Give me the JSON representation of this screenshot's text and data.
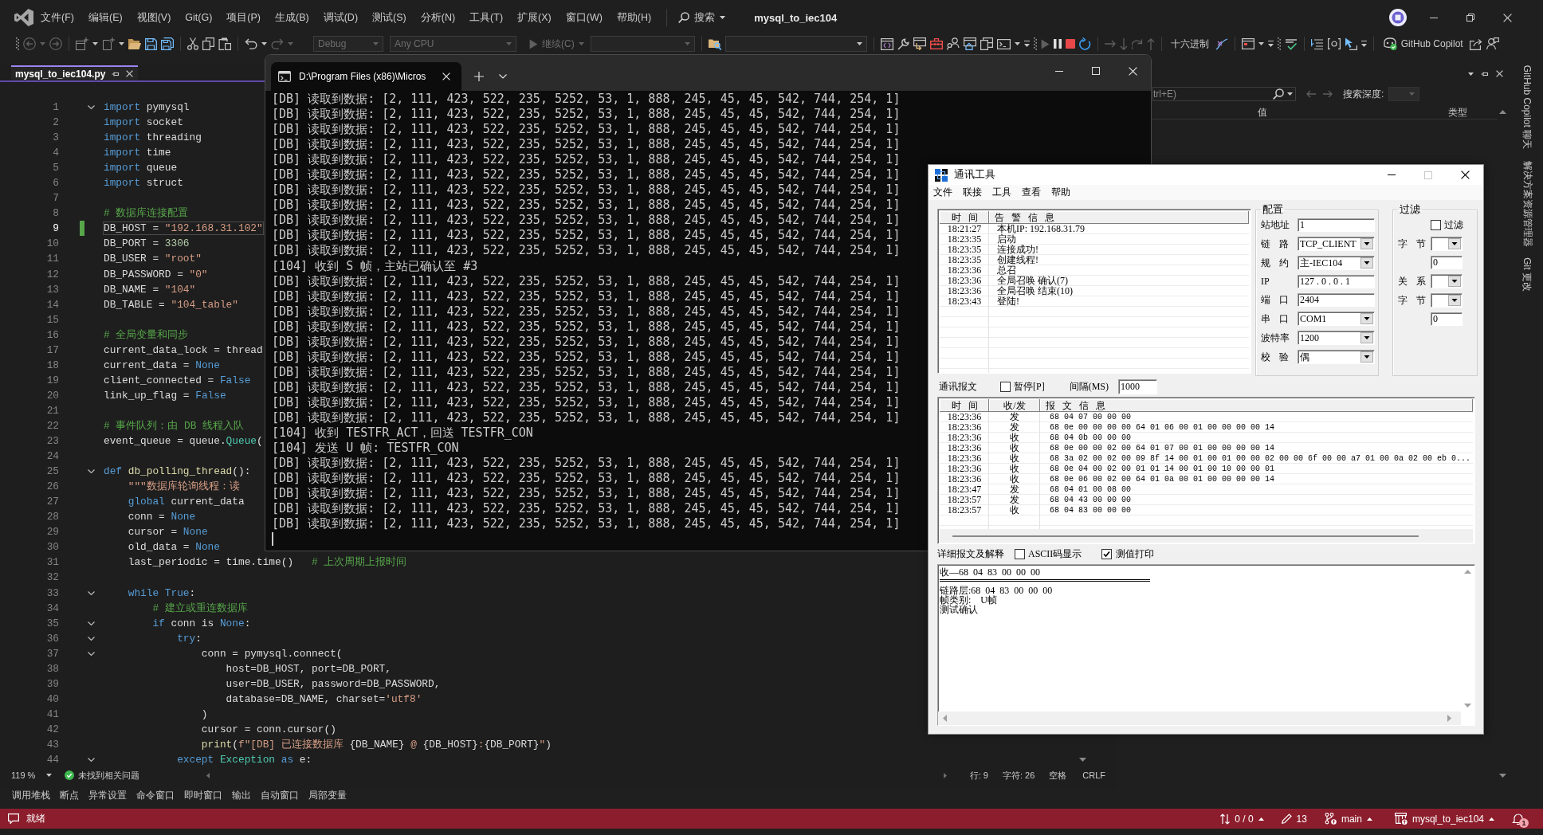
{
  "title_bar": {
    "menus": [
      "文件(F)",
      "编辑(E)",
      "视图(V)",
      "Git(G)",
      "项目(P)",
      "生成(B)",
      "调试(D)",
      "测试(S)",
      "分析(N)",
      "工具(T)",
      "扩展(X)",
      "窗口(W)",
      "帮助(H)"
    ],
    "search": "搜索",
    "title": "mysql_to_iec104"
  },
  "toolbar": {
    "configuration": {
      "value": "Debug",
      "disabled": true
    },
    "platform": {
      "value": "Any CPU",
      "disabled": true
    },
    "continue": {
      "label": "继续(C)",
      "disabled": true
    },
    "hex": "十六进制",
    "copilot": "GitHub Copilot"
  },
  "document_tab": {
    "label": "mysql_to_iec104.py",
    "selected": true
  },
  "editor": {
    "lines": [
      {
        "number": "1",
        "selected": false,
        "modified": false,
        "expanded": true,
        "segments": [
          {
            "kind": "keyword",
            "text": "import"
          },
          {
            "kind": "plain",
            "text": " pymysql"
          }
        ]
      },
      {
        "number": "2",
        "selected": false,
        "modified": false,
        "segments": [
          {
            "kind": "keyword",
            "text": "import"
          },
          {
            "kind": "plain",
            "text": " socket"
          }
        ]
      },
      {
        "number": "3",
        "selected": false,
        "modified": false,
        "segments": [
          {
            "kind": "keyword",
            "text": "import"
          },
          {
            "kind": "plain",
            "text": " threading"
          }
        ]
      },
      {
        "number": "4",
        "selected": false,
        "modified": false,
        "segments": [
          {
            "kind": "keyword",
            "text": "import"
          },
          {
            "kind": "plain",
            "text": " time"
          }
        ]
      },
      {
        "number": "5",
        "selected": false,
        "modified": false,
        "segments": [
          {
            "kind": "keyword",
            "text": "import"
          },
          {
            "kind": "plain",
            "text": " queue"
          }
        ]
      },
      {
        "number": "6",
        "selected": false,
        "modified": false,
        "segments": [
          {
            "kind": "keyword",
            "text": "import"
          },
          {
            "kind": "plain",
            "text": " struct"
          }
        ]
      },
      {
        "number": "7",
        "selected": false,
        "modified": false
      },
      {
        "number": "8",
        "selected": false,
        "modified": false,
        "segments": [
          {
            "kind": "comment",
            "text": "# 数据库连接配置"
          }
        ]
      },
      {
        "number": "9",
        "selected": true,
        "modified": true,
        "segments": [
          {
            "kind": "plain",
            "text": "DB_HOST = "
          },
          {
            "kind": "string",
            "text": "\"192.168.31.102\""
          }
        ]
      },
      {
        "number": "10",
        "selected": false,
        "modified": false,
        "segments": [
          {
            "kind": "plain",
            "text": "DB_PORT = "
          },
          {
            "kind": "number",
            "text": "3306"
          }
        ]
      },
      {
        "number": "11",
        "selected": false,
        "modified": false,
        "segments": [
          {
            "kind": "plain",
            "text": "DB_USER = "
          },
          {
            "kind": "string",
            "text": "\"root\""
          }
        ]
      },
      {
        "number": "12",
        "selected": false,
        "modified": false,
        "segments": [
          {
            "kind": "plain",
            "text": "DB_PASSWORD = "
          },
          {
            "kind": "string",
            "text": "\"0\""
          }
        ]
      },
      {
        "number": "13",
        "selected": false,
        "modified": false,
        "segments": [
          {
            "kind": "plain",
            "text": "DB_NAME = "
          },
          {
            "kind": "string",
            "text": "\"104\""
          }
        ]
      },
      {
        "number": "14",
        "selected": false,
        "modified": false,
        "segments": [
          {
            "kind": "plain",
            "text": "DB_TABLE = "
          },
          {
            "kind": "string",
            "text": "\"104_table\""
          }
        ]
      },
      {
        "number": "15",
        "selected": false,
        "modified": false
      },
      {
        "number": "16",
        "selected": false,
        "modified": false,
        "segments": [
          {
            "kind": "comment",
            "text": "# 全局变量和同步"
          }
        ]
      },
      {
        "number": "17",
        "selected": false,
        "modified": false,
        "segments": [
          {
            "kind": "plain",
            "text": "current_data_lock = thread"
          }
        ]
      },
      {
        "number": "18",
        "selected": false,
        "modified": false,
        "segments": [
          {
            "kind": "plain",
            "text": "current_data = "
          },
          {
            "kind": "keyword",
            "text": "None"
          }
        ]
      },
      {
        "number": "19",
        "selected": false,
        "modified": false,
        "segments": [
          {
            "kind": "plain",
            "text": "client_connected = "
          },
          {
            "kind": "keyword",
            "text": "False"
          }
        ]
      },
      {
        "number": "20",
        "selected": false,
        "modified": false,
        "segments": [
          {
            "kind": "plain",
            "text": "link_up_flag = "
          },
          {
            "kind": "keyword",
            "text": "False"
          }
        ]
      },
      {
        "number": "21",
        "selected": false,
        "modified": false
      },
      {
        "number": "22",
        "selected": false,
        "modified": false,
        "segments": [
          {
            "kind": "comment",
            "text": "# 事件队列：由 DB 线程入队"
          }
        ]
      },
      {
        "number": "23",
        "selected": false,
        "modified": false,
        "segments": [
          {
            "kind": "plain",
            "text": "event_queue = queue."
          },
          {
            "kind": "class",
            "text": "Queue"
          },
          {
            "kind": "plain",
            "text": "("
          }
        ]
      },
      {
        "number": "24",
        "selected": false,
        "modified": false
      },
      {
        "number": "25",
        "selected": false,
        "modified": false,
        "expanded": true,
        "segments": [
          {
            "kind": "keyword",
            "text": "def"
          },
          {
            "kind": "function",
            "text": " db_polling_thread"
          },
          {
            "kind": "plain",
            "text": "():"
          }
        ]
      },
      {
        "number": "26",
        "selected": false,
        "modified": false,
        "segments": [
          {
            "kind": "string",
            "text": "    \"\"\"数据库轮询线程：读"
          }
        ]
      },
      {
        "number": "27",
        "selected": false,
        "modified": false,
        "segments": [
          {
            "kind": "keyword",
            "text": "    global"
          },
          {
            "kind": "plain",
            "text": " current_data"
          }
        ]
      },
      {
        "number": "28",
        "selected": false,
        "modified": false,
        "segments": [
          {
            "kind": "plain",
            "text": "    conn = "
          },
          {
            "kind": "keyword",
            "text": "None"
          }
        ]
      },
      {
        "number": "29",
        "selected": false,
        "modified": false,
        "segments": [
          {
            "kind": "plain",
            "text": "    cursor = "
          },
          {
            "kind": "keyword",
            "text": "None"
          }
        ]
      },
      {
        "number": "30",
        "selected": false,
        "modified": false,
        "segments": [
          {
            "kind": "plain",
            "text": "    old_data = "
          },
          {
            "kind": "keyword",
            "text": "None"
          }
        ]
      },
      {
        "number": "31",
        "selected": false,
        "modified": false,
        "segments": [
          {
            "kind": "plain",
            "text": "    last_periodic = time.time()   "
          },
          {
            "kind": "comment",
            "text": "# 上次周期上报时间"
          }
        ]
      },
      {
        "number": "32",
        "selected": false,
        "modified": false
      },
      {
        "number": "33",
        "selected": false,
        "modified": false,
        "expanded": true,
        "segments": [
          {
            "kind": "keyword",
            "text": "    while True"
          },
          {
            "kind": "plain",
            "text": ":"
          }
        ]
      },
      {
        "number": "34",
        "selected": false,
        "modified": false,
        "segments": [
          {
            "kind": "comment",
            "text": "        # 建立或重连数据库"
          }
        ]
      },
      {
        "number": "35",
        "selected": false,
        "modified": false,
        "expanded": true,
        "segments": [
          {
            "kind": "keyword",
            "text": "        if"
          },
          {
            "kind": "plain",
            "text": " conn is "
          },
          {
            "kind": "keyword",
            "text": "None"
          },
          {
            "kind": "plain",
            "text": ":"
          }
        ]
      },
      {
        "number": "36",
        "selected": false,
        "modified": false,
        "expanded": true,
        "segments": [
          {
            "kind": "keyword",
            "text": "            try"
          },
          {
            "kind": "plain",
            "text": ":"
          }
        ]
      },
      {
        "number": "37",
        "selected": false,
        "modified": false,
        "expanded": true,
        "segments": [
          {
            "kind": "plain",
            "text": "                conn = pymysql.connect("
          }
        ]
      },
      {
        "number": "38",
        "selected": false,
        "modified": false,
        "segments": [
          {
            "kind": "plain",
            "text": "                    host=DB_HOST, port=DB_PORT,"
          }
        ]
      },
      {
        "number": "39",
        "selected": false,
        "modified": false,
        "segments": [
          {
            "kind": "plain",
            "text": "                    user=DB_USER, password=DB_PASSWORD,"
          }
        ]
      },
      {
        "number": "40",
        "selected": false,
        "modified": false,
        "segments": [
          {
            "kind": "plain",
            "text": "                    database=DB_NAME, charset="
          },
          {
            "kind": "string",
            "text": "'utf8'"
          }
        ]
      },
      {
        "number": "41",
        "selected": false,
        "modified": false,
        "segments": [
          {
            "kind": "plain",
            "text": "                )"
          }
        ]
      },
      {
        "number": "42",
        "selected": false,
        "modified": false,
        "segments": [
          {
            "kind": "plain",
            "text": "                cursor = conn.cursor()"
          }
        ]
      },
      {
        "number": "43",
        "selected": false,
        "modified": false,
        "segments": [
          {
            "kind": "function",
            "text": "                print"
          },
          {
            "kind": "plain",
            "text": "("
          },
          {
            "kind": "string",
            "text": "f\"[DB] 已连接数据库 "
          },
          {
            "kind": "plain",
            "text": "{DB_NAME}"
          },
          {
            "kind": "string",
            "text": " @ "
          },
          {
            "kind": "plain",
            "text": "{DB_HOST}"
          },
          {
            "kind": "string",
            "text": ":"
          },
          {
            "kind": "plain",
            "text": "{DB_PORT}"
          },
          {
            "kind": "string",
            "text": "\""
          },
          {
            "kind": "plain",
            "text": ")"
          }
        ]
      },
      {
        "number": "44",
        "selected": false,
        "modified": false,
        "expanded": true,
        "segments": [
          {
            "kind": "keyword",
            "text": "            except"
          },
          {
            "kind": "class",
            "text": " Exception"
          },
          {
            "kind": "keyword",
            "text": " as"
          },
          {
            "kind": "plain",
            "text": " e:"
          }
        ]
      }
    ],
    "status": {
      "zoom": "119 %",
      "issues": "未找到相关问题",
      "line": "行: 9",
      "column": "字符: 26",
      "indentation": "空格",
      "line_ending": "CRLF"
    }
  },
  "locals_panel": {
    "search": {
      "placeholder": "trl+E)"
    },
    "depth_label": "搜索深度:",
    "columns": [
      "值",
      "类型"
    ]
  },
  "side_tabs": [
    "GitHub Copilot 聊天",
    "解决方案资源管理器",
    "Git 更改"
  ],
  "tool_tabs": [
    "调用堆栈",
    "断点",
    "异常设置",
    "命令窗口",
    "即时窗口",
    "输出",
    "自动窗口",
    "局部变量"
  ],
  "status_bar": {
    "state": "就绪",
    "changes": "0 / 0",
    "edits": "13",
    "branch": "main",
    "repository": "mysql_to_iec104",
    "notifications": "1"
  },
  "terminal": {
    "tab_title": "D:\\Program Files (x86)\\Micros",
    "lines": [
      "[DB] 读取到数据: [2, 111, 423, 522, 235, 5252, 53, 1, 888, 245, 45, 45, 542, 744, 254, 1]",
      "[DB] 读取到数据: [2, 111, 423, 522, 235, 5252, 53, 1, 888, 245, 45, 45, 542, 744, 254, 1]",
      "[DB] 读取到数据: [2, 111, 423, 522, 235, 5252, 53, 1, 888, 245, 45, 45, 542, 744, 254, 1]",
      "[DB] 读取到数据: [2, 111, 423, 522, 235, 5252, 53, 1, 888, 245, 45, 45, 542, 744, 254, 1]",
      "[DB] 读取到数据: [2, 111, 423, 522, 235, 5252, 53, 1, 888, 245, 45, 45, 542, 744, 254, 1]",
      "[DB] 读取到数据: [2, 111, 423, 522, 235, 5252, 53, 1, 888, 245, 45, 45, 542, 744, 254, 1]",
      "[DB] 读取到数据: [2, 111, 423, 522, 235, 5252, 53, 1, 888, 245, 45, 45, 542, 744, 254, 1]",
      "[DB] 读取到数据: [2, 111, 423, 522, 235, 5252, 53, 1, 888, 245, 45, 45, 542, 744, 254, 1]",
      "[DB] 读取到数据: [2, 111, 423, 522, 235, 5252, 53, 1, 888, 245, 45, 45, 542, 744, 254, 1]",
      "[DB] 读取到数据: [2, 111, 423, 522, 235, 5252, 53, 1, 888, 245, 45, 45, 542, 744, 254, 1]",
      "[DB] 读取到数据: [2, 111, 423, 522, 235, 5252, 53, 1, 888, 245, 45, 45, 542, 744, 254, 1]",
      "[104] 收到 S 帧，主站已确认至 #3",
      "[DB] 读取到数据: [2, 111, 423, 522, 235, 5252, 53, 1, 888, 245, 45, 45, 542, 744, 254, 1]",
      "[DB] 读取到数据: [2, 111, 423, 522, 235, 5252, 53, 1, 888, 245, 45, 45, 542, 744, 254, 1]",
      "[DB] 读取到数据: [2, 111, 423, 522, 235, 5252, 53, 1, 888, 245, 45, 45, 542, 744, 254, 1]",
      "[DB] 读取到数据: [2, 111, 423, 522, 235, 5252, 53, 1, 888, 245, 45, 45, 542, 744, 254, 1]",
      "[DB] 读取到数据: [2, 111, 423, 522, 235, 5252, 53, 1, 888, 245, 45, 45, 542, 744, 254, 1]",
      "[DB] 读取到数据: [2, 111, 423, 522, 235, 5252, 53, 1, 888, 245, 45, 45, 542, 744, 254, 1]",
      "[DB] 读取到数据: [2, 111, 423, 522, 235, 5252, 53, 1, 888, 245, 45, 45, 542, 744, 254, 1]",
      "[DB] 读取到数据: [2, 111, 423, 522, 235, 5252, 53, 1, 888, 245, 45, 45, 542, 744, 254, 1]",
      "[DB] 读取到数据: [2, 111, 423, 522, 235, 5252, 53, 1, 888, 245, 45, 45, 542, 744, 254, 1]",
      "[DB] 读取到数据: [2, 111, 423, 522, 235, 5252, 53, 1, 888, 245, 45, 45, 542, 744, 254, 1]",
      "[104] 收到 TESTFR_ACT，回送 TESTFR_CON",
      "[104] 发送 U 帧: TESTFR_CON",
      "[DB] 读取到数据: [2, 111, 423, 522, 235, 5252, 53, 1, 888, 245, 45, 45, 542, 744, 254, 1]",
      "[DB] 读取到数据: [2, 111, 423, 522, 235, 5252, 53, 1, 888, 245, 45, 45, 542, 744, 254, 1]",
      "[DB] 读取到数据: [2, 111, 423, 522, 235, 5252, 53, 1, 888, 245, 45, 45, 542, 744, 254, 1]",
      "[DB] 读取到数据: [2, 111, 423, 522, 235, 5252, 53, 1, 888, 245, 45, 45, 542, 744, 254, 1]",
      "[DB] 读取到数据: [2, 111, 423, 522, 235, 5252, 53, 1, 888, 245, 45, 45, 542, 744, 254, 1]"
    ]
  },
  "comm_tool": {
    "title": "通讯工具",
    "menus": [
      "文件",
      "联接",
      "工具",
      "查看",
      "帮助"
    ],
    "alarm_list": {
      "columns": [
        "时 间",
        "告 警 信 息"
      ],
      "rows": [
        {
          "time": "18:21:27",
          "message": "本机IP: 192.168.31.79"
        },
        {
          "time": "18:23:35",
          "message": "启动"
        },
        {
          "time": "18:23:35",
          "message": "连接成功!"
        },
        {
          "time": "18:23:35",
          "message": "创建线程!"
        },
        {
          "time": "18:23:36",
          "message": "总召"
        },
        {
          "time": "18:23:36",
          "message": "全局召唤 确认(7)"
        },
        {
          "time": "18:23:36",
          "message": "全局召唤 结束(10)"
        },
        {
          "time": "18:23:43",
          "message": "登陆!"
        }
      ]
    },
    "config": {
      "title": "配置",
      "fields": [
        {
          "label": "站地址",
          "kind": "text",
          "value": "1"
        },
        {
          "label": "链 路",
          "kind": "dropdown",
          "value": "TCP_CLIENT"
        },
        {
          "label": "规 约",
          "kind": "dropdown",
          "value": "主-IEC104"
        },
        {
          "label": "IP",
          "kind": "ip",
          "value": "127 . 0 . 0 . 1"
        },
        {
          "label": "端 口",
          "kind": "text",
          "value": "2404"
        },
        {
          "label": "串 口",
          "kind": "dropdown",
          "value": "COM1"
        },
        {
          "label": "波特率",
          "kind": "dropdown",
          "value": "1200"
        },
        {
          "label": "校 验",
          "kind": "dropdown",
          "value": "偶"
        }
      ]
    },
    "filter": {
      "title": "过滤",
      "enable": {
        "label": "过滤",
        "checked": false
      },
      "fields": [
        {
          "label": "字 节",
          "kind": "dropdown"
        },
        {
          "kind": "text",
          "value": "0"
        },
        {
          "label": "关 系",
          "kind": "dropdown"
        },
        {
          "label": "字 节",
          "kind": "dropdown"
        },
        {
          "kind": "text",
          "value": "0"
        }
      ]
    },
    "messages": {
      "title": "通讯报文",
      "pause": {
        "label": "暂停[P]",
        "checked": false
      },
      "interval_label": "间隔(MS)",
      "interval": "1000",
      "columns": [
        "时 间",
        "收/发",
        "报 文 信 息"
      ],
      "rows": [
        {
          "time": "18:23:36",
          "direction": "发",
          "frame": "68 04 07 00 00 00"
        },
        {
          "time": "18:23:36",
          "direction": "发",
          "frame": "68 0e 00 00 00 00 64 01 06 00 01 00 00 00 00 14"
        },
        {
          "time": "18:23:36",
          "direction": "收",
          "frame": "68 04 0b 00 00 00"
        },
        {
          "time": "18:23:36",
          "direction": "收",
          "frame": "68 0e 00 00 02 00 64 01 07 00 01 00 00 00 00 14"
        },
        {
          "time": "18:23:36",
          "direction": "收",
          "frame": "68 3a 02 00 02 00 09 8f 14 00 01 00 01 00 00 02 00 00 6f 00 00 a7 01 00 0a 02 00 eb 0..."
        },
        {
          "time": "18:23:36",
          "direction": "收",
          "frame": "68 0e 04 00 02 00 01 01 14 00 01 00 10 00 00 01"
        },
        {
          "time": "18:23:36",
          "direction": "收",
          "frame": "68 0e 06 00 02 00 64 01 0a 00 01 00 00 00 00 14"
        },
        {
          "time": "18:23:47",
          "direction": "发",
          "frame": "68 04 01 00 08 00"
        },
        {
          "time": "18:23:57",
          "direction": "发",
          "frame": "68 04 43 00 00 00"
        },
        {
          "time": "18:23:57",
          "direction": "收",
          "frame": "68 04 83 00 00 00"
        }
      ]
    },
    "detail": {
      "title": "详细报文及解释",
      "ascii": {
        "label": "ASCII码显示",
        "checked": false
      },
      "print_values": {
        "label": "测值打印",
        "checked": true
      },
      "lines": [
        {
          "kind": "text",
          "text": "收—68 04 83 00 00 00"
        },
        {
          "kind": "rule"
        },
        {
          "kind": "text",
          "text": "链路层:68 04 83 00 00 00"
        },
        {
          "kind": "text",
          "text": "帧类别:  U帧"
        },
        {
          "kind": "text",
          "text": "测试确认"
        }
      ]
    }
  }
}
